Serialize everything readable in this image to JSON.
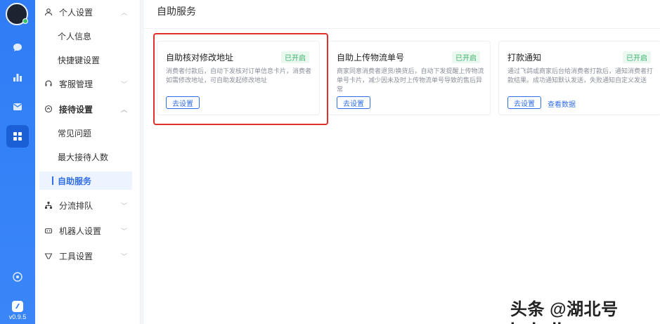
{
  "rail": {
    "version": "v0.9.5",
    "icons": [
      "chat-icon",
      "chart-icon",
      "mail-icon",
      "apps-icon",
      "settings-circle-icon",
      "brand-logo-icon"
    ]
  },
  "menu": {
    "personal_settings": "个人设置",
    "personal_info": "个人信息",
    "shortcut_settings": "快捷键设置",
    "service_management": "客服管理",
    "reception_settings": "接待设置",
    "faq": "常见问题",
    "max_reception": "最大接待人数",
    "self_service": "自助服务",
    "routing_queue": "分流排队",
    "robot_settings": "机器人设置",
    "tool_settings": "工具设置"
  },
  "content": {
    "title": "自助服务",
    "cards": [
      {
        "title": "自助核对修改地址",
        "status": "已开启",
        "description": "消费者付款后，自动下发核对订单信息卡片，消费者如需修改地址，可自助发起修改地址",
        "button": "去设置"
      },
      {
        "title": "自助上传物流单号",
        "status": "已开启",
        "description": "商家同意消费者退货/换货后，自动下发提醒上传物流单号卡片，减少因未及时上传物流单号导致的售后异常",
        "button": "去设置"
      },
      {
        "title": "打款通知",
        "status": "已开启",
        "description": "通过飞鸽或商家后台给消费者打款后，通知消费者打款结果。成功通知默认发送，失败通知自定义发送",
        "button": "去设置",
        "link": "查看数据"
      }
    ]
  },
  "watermark": "头条 @湖北号 hubeihong.com"
}
